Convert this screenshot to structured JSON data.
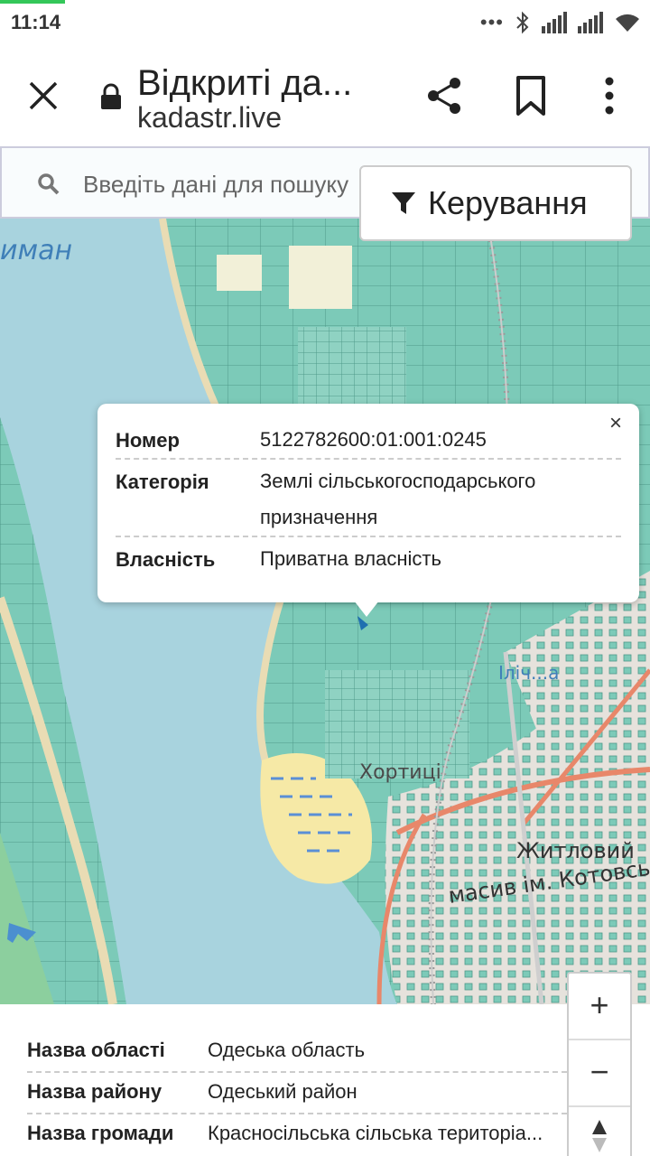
{
  "status_bar": {
    "time": "11:14"
  },
  "browser": {
    "title": "Відкриті да...",
    "url": "kadastr.live"
  },
  "search": {
    "placeholder": "Введіть дані для пошуку"
  },
  "control_button": {
    "label": "Керування"
  },
  "map_labels": {
    "liman_top": "иман",
    "ilichivka": "Іліч...а",
    "khortytsi": "Хортиці",
    "zhytlovyi": "Житловий",
    "masyv": "масив ім. Котовсь"
  },
  "popup": {
    "close_label": "×",
    "rows": [
      {
        "key": "Номер",
        "value": "5122782600:01:001:0245"
      },
      {
        "key": "Категорія",
        "value": "Землі сільськогосподарського призначення"
      },
      {
        "key": "Власність",
        "value": "Приватна власність"
      }
    ]
  },
  "zoom": {
    "in_label": "+",
    "out_label": "−"
  },
  "info": [
    {
      "key": "Назва області",
      "value": "Одеська область"
    },
    {
      "key": "Назва району",
      "value": "Одеський район"
    },
    {
      "key": "Назва громади",
      "value": "Красносільська сільська територіа..."
    }
  ],
  "colors": {
    "water": "#a8d3de",
    "parcel": "#7ccab8",
    "land": "#f1eee8",
    "road": "#e8876a"
  }
}
